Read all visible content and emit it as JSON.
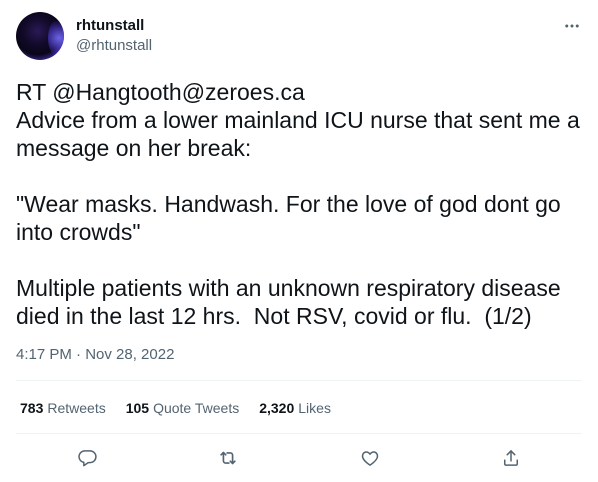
{
  "author": {
    "display_name": "rhtunstall",
    "handle": "@rhtunstall"
  },
  "tweet": {
    "text": "RT @Hangtooth@zeroes.ca\nAdvice from a lower mainland ICU nurse that sent me a message on her break:\n\n\"Wear masks. Handwash. For the love of god dont go into crowds\"\n\nMultiple patients with an unknown respiratory disease died in the last 12 hrs.  Not RSV, covid or flu.  (1/2)",
    "timestamp": "4:17 PM · Nov 28, 2022"
  },
  "stats": {
    "retweets_count": "783",
    "retweets_label": "Retweets",
    "quotes_count": "105",
    "quotes_label": "Quote Tweets",
    "likes_count": "2,320",
    "likes_label": "Likes"
  },
  "icons": {
    "more": "more-icon",
    "reply": "reply-icon",
    "retweet": "retweet-icon",
    "like": "like-icon",
    "share": "share-icon"
  },
  "colors": {
    "text_primary": "#0f1419",
    "text_secondary": "#536471",
    "divider": "#eff3f4"
  }
}
